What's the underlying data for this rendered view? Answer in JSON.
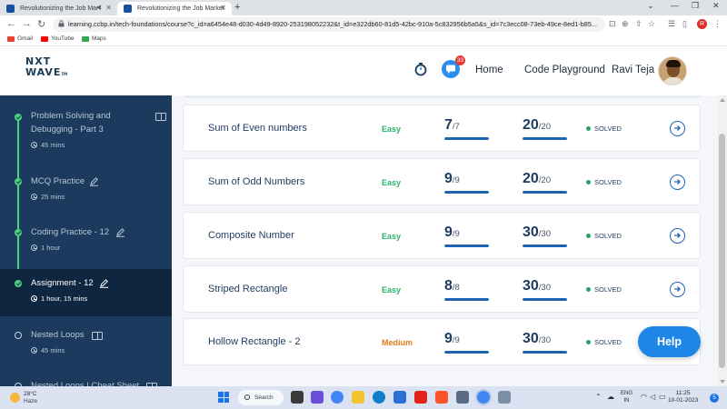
{
  "browser": {
    "tabs": [
      {
        "title": "Revolutionizing the Job Mar"
      },
      {
        "title": "Revolutionizing the Job Market"
      }
    ],
    "url": "learning.ccbp.in/tech-foundations/course?c_id=a6454e48-d030-4d49-8920-253198052232&t_id=e322db60-81d5-42bc-910a-5c832956b5a5&s_id=7c3ecc08-73eb-49ce-8ed1-b85...",
    "profile_initial": "R",
    "bookmarks": [
      {
        "label": "Gmail",
        "color": "#ea4335"
      },
      {
        "label": "YouTube",
        "color": "#ff0000"
      },
      {
        "label": "Maps",
        "color": "#34a853"
      }
    ]
  },
  "header": {
    "logo_line1": "NXT",
    "logo_line2": "WAVE",
    "logo_tm": "TM",
    "chat_badge": "33",
    "nav": {
      "home": "Home",
      "playground": "Code Playground",
      "user": "Ravi Teja"
    }
  },
  "sidebar": {
    "items": [
      {
        "title": "Problem Solving and Debugging - Part 3",
        "duration": "45 mins",
        "status": "done",
        "icon": "book-icon"
      },
      {
        "title": "MCQ Practice",
        "duration": "25 mins",
        "status": "done",
        "icon": "pencil-icon"
      },
      {
        "title": "Coding Practice - 12",
        "duration": "1 hour",
        "status": "done",
        "icon": "pencil-icon"
      },
      {
        "title": "Assignment - 12",
        "duration": "1 hour, 15 mins",
        "status": "done",
        "active": true,
        "icon": "pencil-icon"
      },
      {
        "title": "Nested Loops",
        "duration": "45 mins",
        "status": "todo",
        "icon": "book-icon"
      },
      {
        "title": "Nested Loops | Cheat Sheet",
        "duration": "",
        "status": "todo",
        "icon": "book-icon"
      }
    ]
  },
  "questions": [
    {
      "title": "Sum of Even numbers",
      "difficulty": "Easy",
      "tests_passed": "7",
      "tests_total": "/7",
      "score": "20",
      "score_total": "/20",
      "status": "SOLVED"
    },
    {
      "title": "Sum of Odd Numbers",
      "difficulty": "Easy",
      "tests_passed": "9",
      "tests_total": "/9",
      "score": "20",
      "score_total": "/20",
      "status": "SOLVED"
    },
    {
      "title": "Composite Number",
      "difficulty": "Easy",
      "tests_passed": "9",
      "tests_total": "/9",
      "score": "30",
      "score_total": "/30",
      "status": "SOLVED"
    },
    {
      "title": "Striped Rectangle",
      "difficulty": "Easy",
      "tests_passed": "8",
      "tests_total": "/8",
      "score": "30",
      "score_total": "/30",
      "status": "SOLVED"
    },
    {
      "title": "Hollow Rectangle - 2",
      "difficulty": "Medium",
      "tests_passed": "9",
      "tests_total": "/9",
      "score": "30",
      "score_total": "/30",
      "status": "SOLVED"
    }
  ],
  "colors": {
    "easy": "#2ab36b",
    "medium": "#e07b1a",
    "accent": "#1f63b3",
    "sidebar_bg": "#1b3a5e"
  },
  "help_label": "Help",
  "taskbar": {
    "weather_temp": "28°C",
    "weather_desc": "Haze",
    "search_label": "Search",
    "lang_line1": "ENG",
    "lang_line2": "IN",
    "time": "11:25",
    "date": "10-01-2023",
    "notifications": "5"
  }
}
